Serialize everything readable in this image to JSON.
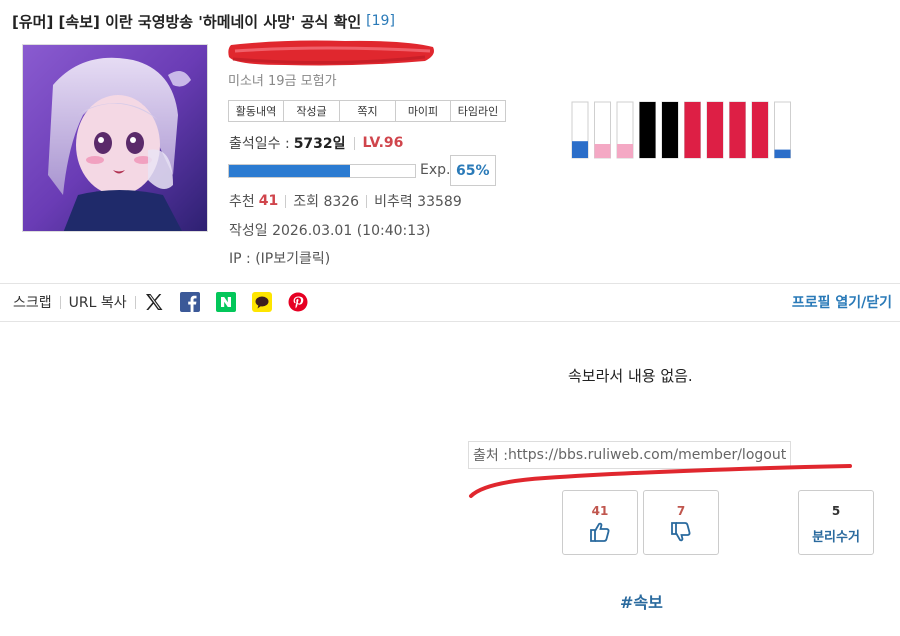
{
  "post": {
    "title": "[유머] [속보] 이란 국영방송 '하메네이 사망' 공식 확인",
    "comment_count": "[19]"
  },
  "author": {
    "member_level": "미소녀 19금 모험가",
    "buttons": [
      "활동내역",
      "작성글",
      "쪽지",
      "마이피",
      "타임라인"
    ],
    "attend_label": "출석일수 :",
    "attend_days": "5732일",
    "level": "LV.96",
    "exp_label": "Exp.",
    "exp_percent": "65%",
    "exp_fraction": 0.65
  },
  "stats": {
    "recommend_label": "추천",
    "recommend_value": "41",
    "views": "조회 8326",
    "nonrec_power": "비추력 33589"
  },
  "meta": {
    "date": "작성일 2026.03.01 (10:40:13)",
    "ip": "IP : (IP보기클릭)"
  },
  "color_bars": [
    {
      "color": "#2b6ec9",
      "fill": 0.3
    },
    {
      "color": "#f4a8c4",
      "fill": 0.25
    },
    {
      "color": "#f4a8c4",
      "fill": 0.25
    },
    {
      "color": "#000000",
      "fill": 1.0
    },
    {
      "color": "#000000",
      "fill": 1.0
    },
    {
      "color": "#dd1f45",
      "fill": 1.0
    },
    {
      "color": "#dd1f45",
      "fill": 1.0
    },
    {
      "color": "#dd1f45",
      "fill": 1.0
    },
    {
      "color": "#dd1f45",
      "fill": 1.0
    },
    {
      "color": "#2b6ec9",
      "fill": 0.15
    }
  ],
  "share": {
    "scrap": "스크랩",
    "copy_url": "URL 복사",
    "icons": [
      "x-icon",
      "facebook-icon",
      "naver-icon",
      "kakaotalk-icon",
      "pinterest-icon"
    ],
    "profile_toggle": "프로필 열기/닫기"
  },
  "content": {
    "body": "속보라서 내용 없음.",
    "source_prefix": "출처 : ",
    "source_url": "https://bbs.ruliweb.com/member/logout"
  },
  "votes": {
    "up": "41",
    "down": "7",
    "separate": "5",
    "separate_label": "분리수거"
  },
  "hashtag": "#속보",
  "colors": {
    "accent_blue": "#2a7ab8",
    "accent_red": "#d0454c",
    "scribble_red": "#e0272e"
  }
}
